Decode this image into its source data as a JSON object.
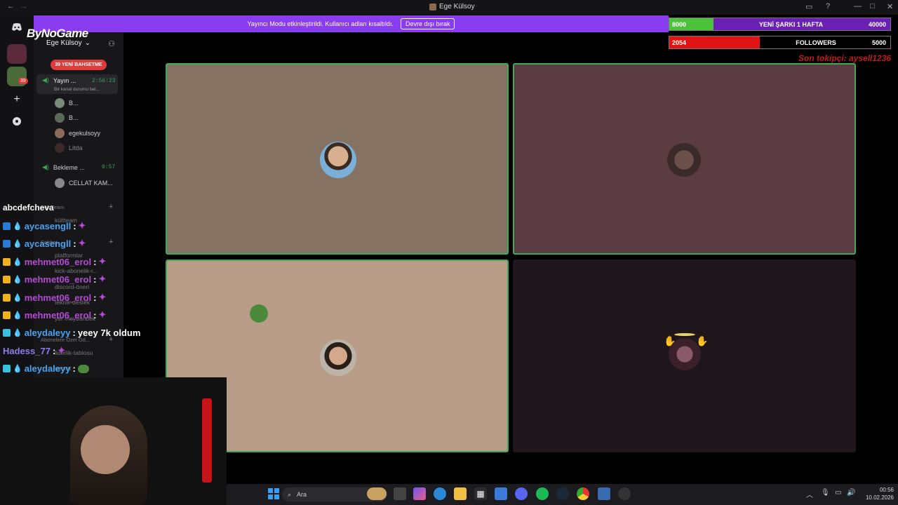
{
  "window": {
    "title": "Ege Külsoy",
    "nav_back": "←",
    "nav_fwd": "→"
  },
  "banner": {
    "text": "Yayıncı Modu etkinleştirildi. Kullanıcı adları kısaltıldı.",
    "button": "Devre dışı bırak"
  },
  "stats": [
    {
      "left": "8000",
      "mid": "YENİ ŞARKI 1 HAFTA",
      "right": "40000",
      "progress": 0.2,
      "color": "#4cc23a"
    },
    {
      "left": "2054",
      "mid": "FOLLOWERS",
      "right": "5000",
      "progress": 0.41,
      "color": "#e01414"
    }
  ],
  "last_tip": "Son tokipçi: aysell1236",
  "overlay_logo": "ByNoGame",
  "server": {
    "name": "Ege Külsoy",
    "mention_badge": "39 YENİ BAHSETME",
    "rail_badge": "39"
  },
  "voice": {
    "channel1": {
      "name": "Yayın ...",
      "time": "2:56:23",
      "status": "Bir kanal durumu bel..."
    },
    "members": [
      "B...",
      "B...",
      "egekulsoyy",
      "Litda"
    ],
    "channel2": {
      "name": "Bekleme ...",
      "time": "0:57"
    },
    "member2": "CELLAT KAM..."
  },
  "categories": [
    "Kült Team",
    "Sohbet",
    "Abonelere Özel Od..."
  ],
  "channels": [
    "kültteam",
    "platformlar",
    "kick-abonelik-r...",
    "discord-öneri",
    "teknik-destek",
    "yar meydandek",
    "liderlik-tablosu",
    "secret"
  ],
  "chat": {
    "top_name": "abcdefcheva",
    "messages": [
      {
        "user": "aycasengll",
        "msg": "",
        "color": "#4aa3f0",
        "emote": "gem"
      },
      {
        "user": "aycasengll",
        "msg": "",
        "color": "#4aa3f0",
        "emote": "gem"
      },
      {
        "user": "mehmet06_erol",
        "msg": "",
        "color": "#b44ad6",
        "emote": "gem"
      },
      {
        "user": "mehmet06_erol",
        "msg": "",
        "color": "#b44ad6",
        "emote": "gem"
      },
      {
        "user": "mehmet06_erol",
        "msg": "",
        "color": "#b44ad6",
        "emote": "gem"
      },
      {
        "user": "mehmet06_erol",
        "msg": "",
        "color": "#b44ad6",
        "emote": "gem"
      },
      {
        "user": "aleydaleyy",
        "msg": "yeey 7k oldum",
        "color": "#4aa3f0",
        "emote": ""
      },
      {
        "user": "Hadess_77",
        "msg": "",
        "color": "#8c7cf0",
        "emote": "gem"
      },
      {
        "user": "aleydaleyy",
        "msg": "",
        "color": "#4aa3f0",
        "emote": "frog"
      }
    ]
  },
  "taskbar": {
    "search_placeholder": "Ara",
    "time": "00:56",
    "date": "10.02.2026"
  },
  "icons": [
    "discord-icon",
    "plus-icon",
    "compass-icon",
    "windows-icon",
    "search-icon",
    "spotify-icon",
    "steam-icon",
    "chrome-icon"
  ]
}
